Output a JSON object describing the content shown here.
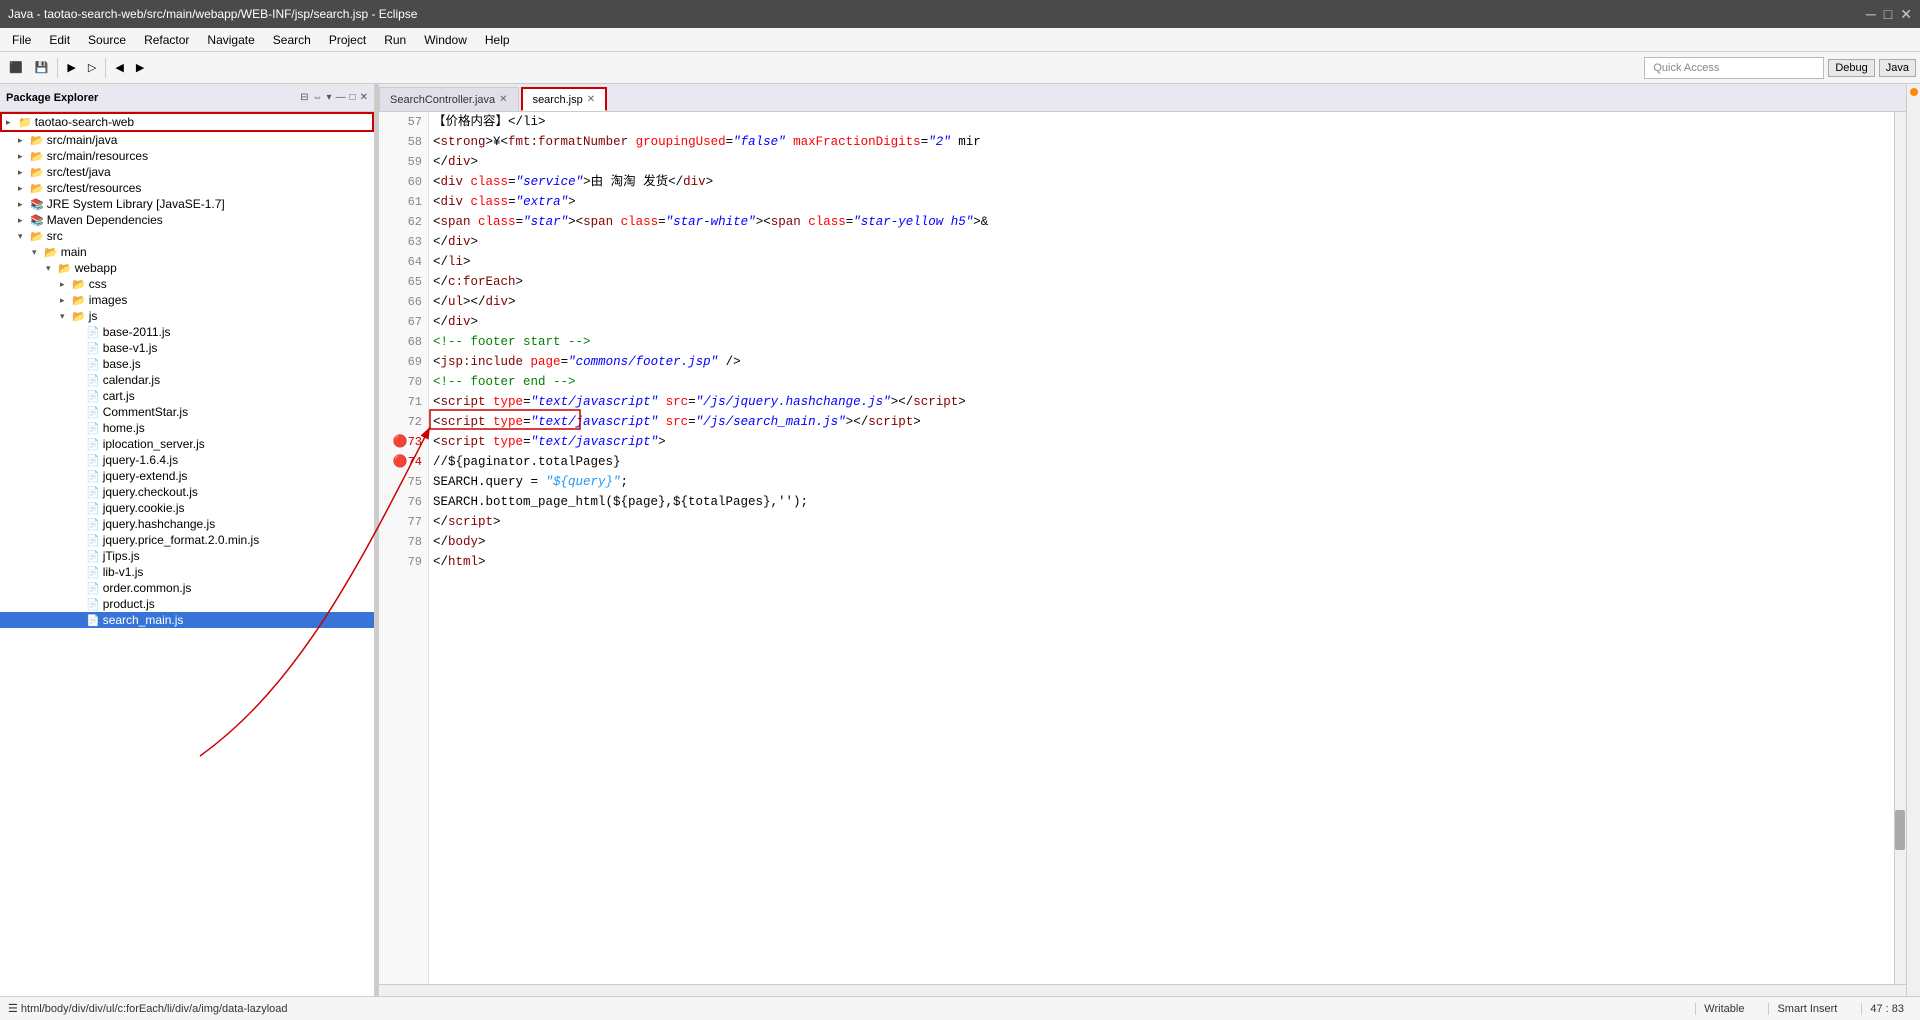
{
  "titlebar": {
    "title": "Java - taotao-search-web/src/main/webapp/WEB-INF/jsp/search.jsp - Eclipse",
    "minimize": "─",
    "maximize": "□",
    "close": "✕"
  },
  "menubar": {
    "items": [
      "File",
      "Edit",
      "Source",
      "Refactor",
      "Navigate",
      "Search",
      "Project",
      "Run",
      "Window",
      "Help"
    ]
  },
  "toolbar": {
    "quick_access_placeholder": "Quick Access",
    "debug_label": "Debug",
    "java_label": "Java"
  },
  "package_explorer": {
    "title": "Package Explorer",
    "root": "taotao-search-web",
    "items": [
      {
        "id": "root",
        "label": "taotao-search-web",
        "indent": 0,
        "type": "project",
        "highlighted": true
      },
      {
        "id": "src-main-java",
        "label": "src/main/java",
        "indent": 1,
        "type": "folder"
      },
      {
        "id": "src-main-resources",
        "label": "src/main/resources",
        "indent": 1,
        "type": "folder"
      },
      {
        "id": "src-test-java",
        "label": "src/test/java",
        "indent": 1,
        "type": "folder"
      },
      {
        "id": "src-test-resources",
        "label": "src/test/resources",
        "indent": 1,
        "type": "folder"
      },
      {
        "id": "jre",
        "label": "JRE System Library [JavaSE-1.7]",
        "indent": 1,
        "type": "library"
      },
      {
        "id": "maven",
        "label": "Maven Dependencies",
        "indent": 1,
        "type": "library"
      },
      {
        "id": "src",
        "label": "src",
        "indent": 1,
        "type": "folder",
        "expanded": true
      },
      {
        "id": "main",
        "label": "main",
        "indent": 2,
        "type": "folder",
        "expanded": true
      },
      {
        "id": "webapp",
        "label": "webapp",
        "indent": 3,
        "type": "folder",
        "expanded": true
      },
      {
        "id": "css",
        "label": "css",
        "indent": 4,
        "type": "folder"
      },
      {
        "id": "images",
        "label": "images",
        "indent": 4,
        "type": "folder"
      },
      {
        "id": "js",
        "label": "js",
        "indent": 4,
        "type": "folder",
        "expanded": true
      },
      {
        "id": "base2011",
        "label": "base-2011.js",
        "indent": 5,
        "type": "file"
      },
      {
        "id": "basev1",
        "label": "base-v1.js",
        "indent": 5,
        "type": "file"
      },
      {
        "id": "base",
        "label": "base.js",
        "indent": 5,
        "type": "file"
      },
      {
        "id": "calendar",
        "label": "calendar.js",
        "indent": 5,
        "type": "file"
      },
      {
        "id": "cart",
        "label": "cart.js",
        "indent": 5,
        "type": "file"
      },
      {
        "id": "commentstar",
        "label": "CommentStar.js",
        "indent": 5,
        "type": "file"
      },
      {
        "id": "home",
        "label": "home.js",
        "indent": 5,
        "type": "file"
      },
      {
        "id": "iplocation",
        "label": "iplocation_server.js",
        "indent": 5,
        "type": "file"
      },
      {
        "id": "jquery164",
        "label": "jquery-1.6.4.js",
        "indent": 5,
        "type": "file"
      },
      {
        "id": "jqueryextend",
        "label": "jquery-extend.js",
        "indent": 5,
        "type": "file"
      },
      {
        "id": "jquerycheckout",
        "label": "jquery.checkout.js",
        "indent": 5,
        "type": "file"
      },
      {
        "id": "jquerycookie",
        "label": "jquery.cookie.js",
        "indent": 5,
        "type": "file"
      },
      {
        "id": "jqueryhashchange",
        "label": "jquery.hashchange.js",
        "indent": 5,
        "type": "file"
      },
      {
        "id": "jquerypriceformat",
        "label": "jquery.price_format.2.0.min.js",
        "indent": 5,
        "type": "file"
      },
      {
        "id": "jtips",
        "label": "jTips.js",
        "indent": 5,
        "type": "file"
      },
      {
        "id": "libv1",
        "label": "lib-v1.js",
        "indent": 5,
        "type": "file"
      },
      {
        "id": "ordercommon",
        "label": "order.common.js",
        "indent": 5,
        "type": "file"
      },
      {
        "id": "product",
        "label": "product.js",
        "indent": 5,
        "type": "file"
      },
      {
        "id": "searchmain",
        "label": "search_main.js",
        "indent": 5,
        "type": "file",
        "selected": true
      }
    ]
  },
  "tabs": [
    {
      "label": "SearchController.java",
      "active": false,
      "closable": true
    },
    {
      "label": "search.jsp",
      "active": true,
      "closable": true,
      "highlighted": true
    }
  ],
  "code": {
    "lines": [
      {
        "num": 57,
        "content": "html",
        "raw": "\t\t【价格内容】</li>"
      },
      {
        "num": 58,
        "content_html": "\t\t\t&lt;<span class='c-tag'>strong</span>&gt;¥&lt;<span class='c-tag'>fmt:formatNumber</span> <span class='c-attr'>groupingUsed</span>=<span class='c-string'>\"false\"</span> <span class='c-attr'>maxFractionDigits</span>=<span class='c-string'>\"2\"</span> mir"
      },
      {
        "num": 59,
        "content_html": "\t\t&lt;/<span class='c-tag'>div</span>&gt;"
      },
      {
        "num": 60,
        "content_html": "\t\t&lt;<span class='c-tag'>div</span> <span class='c-attr'>class</span>=<span class='c-string'>\"service\"</span>&gt;由 淘淘 发货&lt;/<span class='c-tag'>div</span>&gt;"
      },
      {
        "num": 61,
        "content_html": "\t\t&lt;<span class='c-tag'>div</span> <span class='c-attr'>class</span>=<span class='c-string'>\"extra\"</span>&gt;"
      },
      {
        "num": 62,
        "content_html": "\t\t\t&lt;<span class='c-tag'>span</span> <span class='c-attr'>class</span>=<span class='c-string'>\"star\"</span>&gt;&lt;<span class='c-tag'>span</span> <span class='c-attr'>class</span>=<span class='c-string'>\"star-white\"</span>&gt;&lt;<span class='c-tag'>span</span> <span class='c-attr'>class</span>=<span class='c-string'>\"star-yellow h5\"</span>&gt;&amp;"
      },
      {
        "num": 63,
        "content_html": "\t\t&lt;/<span class='c-tag'>div</span>&gt;"
      },
      {
        "num": 64,
        "content_html": "&lt;/<span class='c-tag'>li</span>&gt;"
      },
      {
        "num": 65,
        "content_html": "&lt;/<span class='c-tag'>c:forEach</span>&gt;"
      },
      {
        "num": 66,
        "content_html": "&lt;/<span class='c-tag'>ul</span>&gt;&lt;/<span class='c-tag'>div</span>&gt;"
      },
      {
        "num": 67,
        "content_html": "&lt;/<span class='c-tag'>div</span>&gt;"
      },
      {
        "num": 68,
        "content_html": "<span class='c-comment'>&lt;!-- footer start --&gt;</span>"
      },
      {
        "num": 69,
        "content_html": "&lt;<span class='c-tag'>jsp:include</span> <span class='c-attr'>page</span>=<span class='c-string'>\"commons/footer.jsp\"</span> /&gt;"
      },
      {
        "num": 70,
        "content_html": "<span class='c-comment'>&lt;!-- footer end --&gt;</span>"
      },
      {
        "num": 71,
        "content_html": "&lt;<span class='c-tag'>script</span> <span class='c-attr'>type</span>=<span class='c-string'>\"text/javascript\"</span> <span class='c-attr'>src</span>=<span class='c-string'>\"/js/jquery.hashchange.js\"</span>&gt;&lt;/<span class='c-tag'>script</span>&gt;"
      },
      {
        "num": 72,
        "content_html": "&lt;<span class='c-tag'>script</span> <span class='c-attr'>type</span>=<span class='c-string'>\"text/javascript\"</span> <span class='c-attr'>src</span>=<span class='c-string'>\"/js/search_main.js\"</span>&gt;&lt;/<span class='c-tag'>script</span>&gt;"
      },
      {
        "num": 73,
        "content_html": "&lt;<span class='c-tag'>script</span> <span class='c-attr'>type</span>=<span class='c-string'>\"text/javascript\"</span>&gt;",
        "error": true
      },
      {
        "num": 74,
        "content_html": "//${paginator.totalPages}",
        "error": true
      },
      {
        "num": 75,
        "content_html": "SEARCH.query = <span class='c-js-string'>\"${query}\"</span>;"
      },
      {
        "num": 76,
        "content_html": "SEARCH.bottom_page_html(${page},${totalPages},'');"
      },
      {
        "num": 77,
        "content_html": "&lt;/<span class='c-tag'>script</span>&gt;"
      },
      {
        "num": 78,
        "content_html": "&lt;/<span class='c-tag'>body</span>&gt;"
      },
      {
        "num": 79,
        "content_html": "&lt;/<span class='c-tag'>html</span>&gt;"
      }
    ]
  },
  "statusbar": {
    "path": "☰ html/body/div/div/ul/c:forEach/li/div/a/img/data-lazyload",
    "writable": "Writable",
    "insert": "Smart Insert",
    "position": "47 : 83"
  }
}
